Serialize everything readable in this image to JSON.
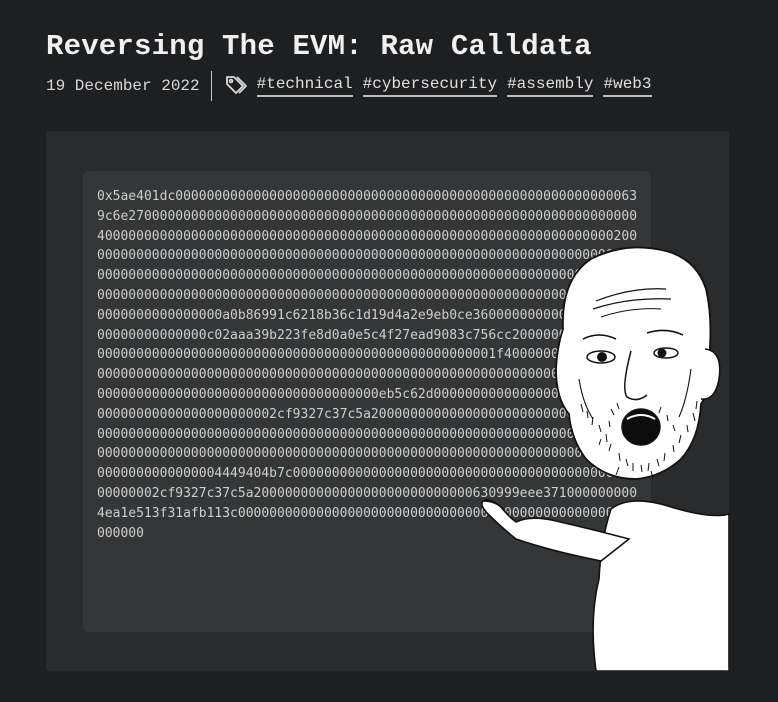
{
  "post": {
    "title": "Reversing The EVM: Raw Calldata",
    "date": "19 December 2022",
    "tags": [
      "#technical",
      "#cybersecurity",
      "#assembly",
      "#web3"
    ]
  },
  "calldata_lines": [
    "0x5ae401dc00000000000000000000000000000000000000000000000000000000063",
    "9c6e27000000000000000000000000000000000000000000000000000000000000000",
    "400000000000000000000000000000000000000000000000000000000000000000200",
    "000000000000000000000000000000000000000000000000000000000000000000000",
    "000000000000000000000000000000000000000000000000000000000000000000000",
    "000000000000000000000000000000000000000000000000000000000000000000000",
    "0000000000000000a0b86991c6218b36c1d19d4a2e9eb0ce3600000000000000000000",
    "00000000000000c02aaa39b223fe8d0a0e5c4f27ead9083c756cc20000000000000000",
    "000000000000000000000000000000000000000000000000001f400000000000000000",
    "000000000000000000000000000000000000000000000000000000000000000000000",
    "000000000000000000000000000000000000eb5c62d000000000000000000000000000",
    "00000000000000000000002cf9327c37c5a2000000000000000000000000000000000",
    "000000000000000000000000000000000000000000000000000000000000000000000",
    "000000000000000000000000000000000000000000000000000000000000000000000",
    "0000000000000004449404b7c00000000000000000000000000000000000000000000",
    "00000002cf9327c37c5a2000000000000000000000000000630999eee371000000000",
    "4ea1e513f31afb113c000000000000000000000000000000000000000000000000000",
    "000000"
  ],
  "icons": {
    "tag": "tag-icon"
  },
  "colors": {
    "background": "#1e1f21",
    "frame": "#2a2b2d",
    "code_bg": "#353637",
    "text": "#e6e6e6"
  }
}
